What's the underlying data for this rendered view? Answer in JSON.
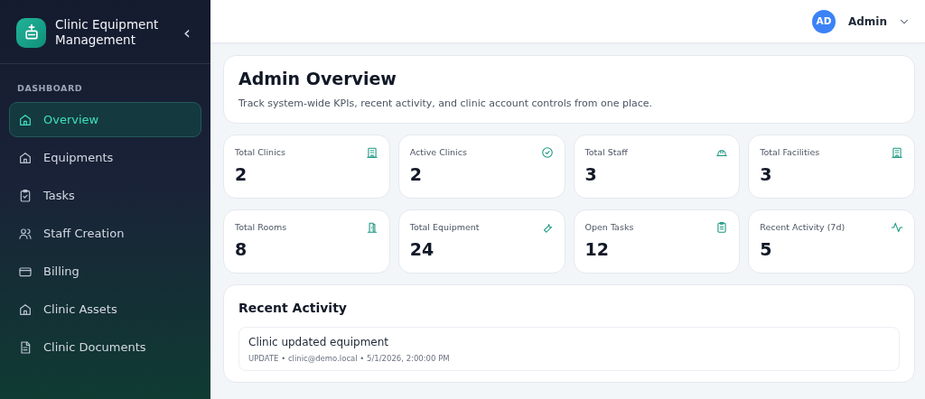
{
  "sidebar": {
    "brand": "Clinic Equipment Management",
    "collapse_icon": "‹",
    "section": "DASHBOARD",
    "items": [
      {
        "label": "Overview",
        "selected": true
      },
      {
        "label": "Equipments",
        "selected": false
      },
      {
        "label": "Tasks",
        "selected": false
      },
      {
        "label": "Staff Creation",
        "selected": false
      },
      {
        "label": "Billing",
        "selected": false
      },
      {
        "label": "Clinic Assets",
        "selected": false
      },
      {
        "label": "Clinic Documents",
        "selected": false
      }
    ]
  },
  "topbar": {
    "avatar": "AD",
    "user": "Admin"
  },
  "header": {
    "title": "Admin Overview",
    "subtitle": "Track system-wide KPIs, recent activity, and clinic account controls from one place."
  },
  "stats": [
    {
      "label": "Total Clinics",
      "value": "2"
    },
    {
      "label": "Active Clinics",
      "value": "2"
    },
    {
      "label": "Total Staff",
      "value": "3"
    },
    {
      "label": "Total Facilities",
      "value": "3"
    },
    {
      "label": "Total Rooms",
      "value": "8"
    },
    {
      "label": "Total Equipment",
      "value": "24"
    },
    {
      "label": "Open Tasks",
      "value": "12"
    },
    {
      "label": "Recent Activity (7d)",
      "value": "5"
    }
  ],
  "recent_activity": {
    "title": "Recent Activity",
    "items": [
      {
        "title": "Clinic updated equipment",
        "meta": "UPDATE • clinic@demo.local • 5/1/2026, 2:00:00 PM"
      }
    ]
  }
}
